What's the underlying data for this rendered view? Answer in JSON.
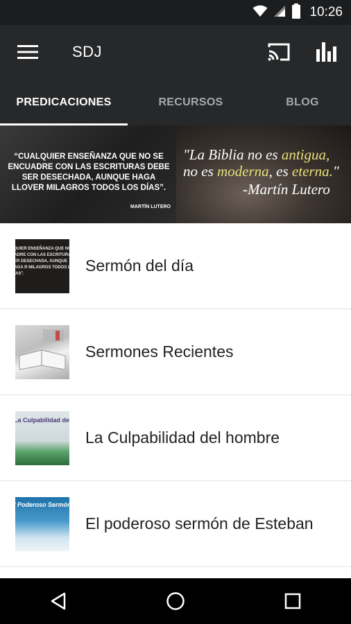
{
  "status_bar": {
    "time": "10:26",
    "icons": [
      "wifi-icon",
      "signal-icon",
      "battery-icon"
    ]
  },
  "app_bar": {
    "title": "SDJ",
    "icons": [
      "menu-icon",
      "cast-icon",
      "bar-chart-icon"
    ]
  },
  "tabs": [
    {
      "label": "PREDICACIONES",
      "selected": true
    },
    {
      "label": "RECURSOS",
      "selected": false
    },
    {
      "label": "BLOG",
      "selected": false
    }
  ],
  "banner": {
    "left_quote": "“CUALQUIER ENSEÑANZA QUE NO SE ENCUADRE CON LAS ESCRITURAS DEBE SER DESECHADA, AUNQUE HAGA LLOVER MILAGROS TODOS LOS DÍAS”.",
    "left_author": "MARTÍN LUTERO",
    "right_quote": {
      "line1_a": "\"La Biblia no es ",
      "line1_b": "antigua,",
      "line2_a": "no es ",
      "line2_b": "moderna",
      "line2_c": ", es ",
      "line2_d": "eterna.",
      "line2_e": "\"",
      "line3": "-Martín Lutero"
    }
  },
  "list_items": [
    {
      "label": "Sermón del día",
      "thumb_text": "LQUIER ENSEÑANZA QUE NO SE UADRE CON LAS ESCRITURAS E SER DESECHADA, AUNQUE HAGA R MILAGROS TODOS LOS DÍAS\"."
    },
    {
      "label": "Sermones Recientes",
      "thumb_text": ""
    },
    {
      "label": "La Culpabilidad del hombre",
      "thumb_text": "La Culpabilidad del Hombre"
    },
    {
      "label": "El poderoso sermón de Esteban",
      "thumb_text": "l Poderoso Sermón de Esteba"
    }
  ],
  "nav_bar": {
    "icons": [
      "back-icon",
      "home-icon",
      "recents-icon"
    ]
  },
  "colors": {
    "status_bar": "#1c1d1f",
    "app_bar": "#27282a",
    "tab_inactive_text": "#a8a9ab",
    "list_text": "#212121",
    "nav_bar": "#000000"
  }
}
